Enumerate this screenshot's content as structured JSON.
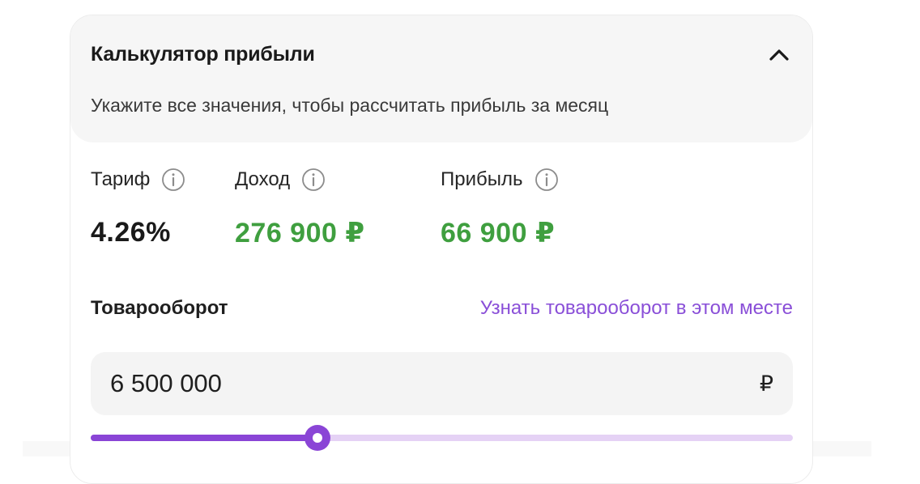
{
  "calculator": {
    "title": "Калькулятор прибыли",
    "subtitle": "Укажите все значения, чтобы рассчитать прибыль за месяц",
    "metrics": [
      {
        "label": "Тариф",
        "value": "4.26%",
        "color": "#1a1a1a"
      },
      {
        "label": "Доход",
        "value": "276 900 ₽",
        "color": "#3f9f3f"
      },
      {
        "label": "Прибыль",
        "value": "66 900 ₽",
        "color": "#3f9f3f"
      }
    ],
    "turnover": {
      "label": "Товарооборот",
      "link": "Узнать товарооборот в этом месте",
      "value": "6 500 000",
      "currency": "₽",
      "slider_fraction": 0.323
    },
    "icons": {
      "collapse": "chevron-up-icon",
      "info": "info-icon"
    },
    "colors": {
      "accent": "#8a45d6",
      "link": "#8a4fd8",
      "positive": "#3f9f3f"
    }
  }
}
